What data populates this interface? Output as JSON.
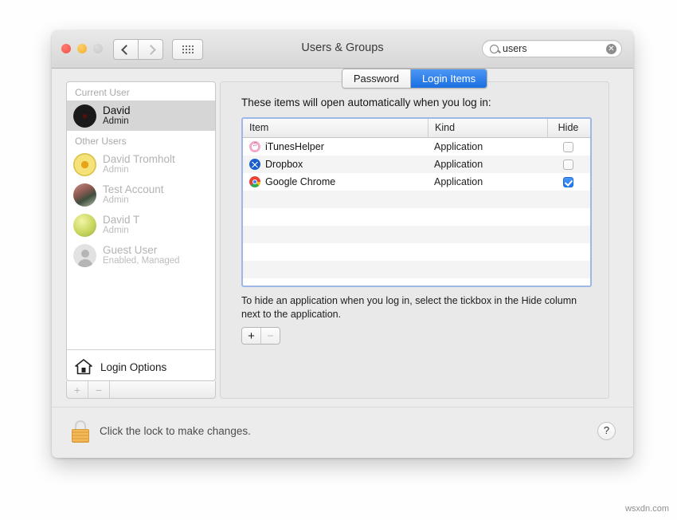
{
  "window": {
    "title": "Users & Groups",
    "traffic_lights": [
      "close",
      "minimize",
      "zoom"
    ],
    "nav": {
      "back": "back-chevron",
      "forward": "forward-chevron",
      "grid": "show-all-grid"
    },
    "search": {
      "value": "users",
      "placeholder": "Search",
      "clear_glyph": "✕"
    }
  },
  "sidebar": {
    "groups": [
      {
        "header": "Current User",
        "users": [
          {
            "name": "David",
            "role": "Admin",
            "avatar": "av-david",
            "selected": true,
            "dimmed": false
          }
        ]
      },
      {
        "header": "Other Users",
        "users": [
          {
            "name": "David Tromholt",
            "role": "Admin",
            "avatar": "av-sun",
            "selected": false,
            "dimmed": true
          },
          {
            "name": "Test Account",
            "role": "Admin",
            "avatar": "av-photo",
            "selected": false,
            "dimmed": true
          },
          {
            "name": "David T",
            "role": "Admin",
            "avatar": "av-green",
            "selected": false,
            "dimmed": true
          },
          {
            "name": "Guest User",
            "role": "Enabled, Managed",
            "avatar": "av-guest",
            "selected": false,
            "dimmed": true
          }
        ]
      }
    ],
    "login_options": {
      "label": "Login Options",
      "icon": "house-icon"
    },
    "add_button": "+",
    "remove_button": "−"
  },
  "tabs": [
    {
      "label": "Password",
      "active": false
    },
    {
      "label": "Login Items",
      "active": true
    }
  ],
  "main": {
    "note": "These items will open automatically when you log in:",
    "columns": [
      "Item",
      "Kind",
      "Hide"
    ],
    "rows": [
      {
        "item": "iTunesHelper",
        "kind": "Application",
        "hide": false,
        "icon": "ic-itunes"
      },
      {
        "item": "Dropbox",
        "kind": "Application",
        "hide": false,
        "icon": "ic-dropbox"
      },
      {
        "item": "Google Chrome",
        "kind": "Application",
        "hide": true,
        "icon": "ic-chrome"
      }
    ],
    "empty_row_count": 6,
    "hint": "To hide an application when you log in, select the tickbox in the Hide column next to the application.",
    "add_button": "+",
    "remove_button": "−"
  },
  "footer": {
    "lock_text": "Click the lock to make changes.",
    "lock_state": "locked",
    "help_label": "?"
  },
  "watermark": "wsxdn.com",
  "colors": {
    "accent_blue": "#1a78ee",
    "tab_active": "#2f85ef",
    "focus_ring": "#9cb7e8",
    "lock_gold": "#e8a945",
    "window_chrome": "#ececec"
  }
}
